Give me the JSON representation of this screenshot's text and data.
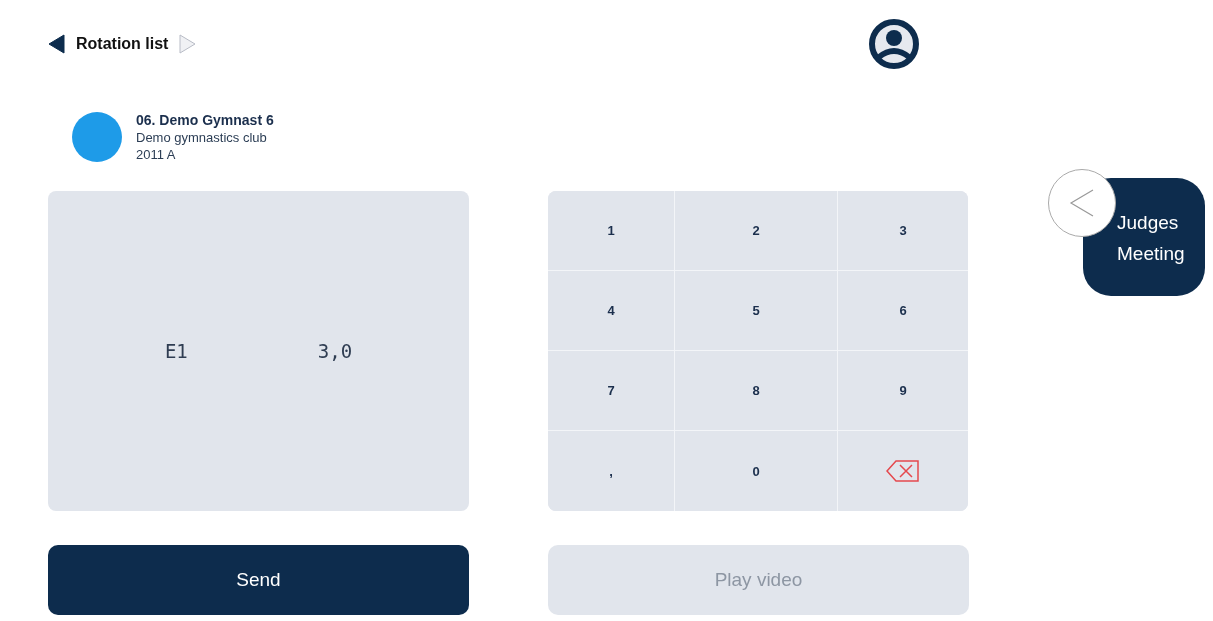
{
  "nav": {
    "title": "Rotation list",
    "previous": {
      "disabled": false
    },
    "next": {
      "disabled": true
    }
  },
  "gymnast": {
    "color": "#1e9be8",
    "name": "06. Demo Gymnast 6",
    "club": "Demo gymnastics club",
    "category": "2011 A"
  },
  "score": {
    "label": "E1",
    "value": "3,0"
  },
  "keypad": [
    {
      "kind": "key",
      "label": "1"
    },
    {
      "kind": "key",
      "label": "2"
    },
    {
      "kind": "key",
      "label": "3"
    },
    {
      "kind": "key",
      "label": "4"
    },
    {
      "kind": "key",
      "label": "5"
    },
    {
      "kind": "key",
      "label": "6"
    },
    {
      "kind": "key",
      "label": "7"
    },
    {
      "kind": "key",
      "label": "8"
    },
    {
      "kind": "key",
      "label": "9"
    },
    {
      "kind": "key",
      "label": ","
    },
    {
      "kind": "key",
      "label": "0"
    },
    {
      "kind": "backspace"
    }
  ],
  "buttons": [
    {
      "label": "Send",
      "disabled": false
    },
    {
      "label": "Play video",
      "disabled": true
    }
  ],
  "side_panel": {
    "label": "Judges Meeting"
  }
}
